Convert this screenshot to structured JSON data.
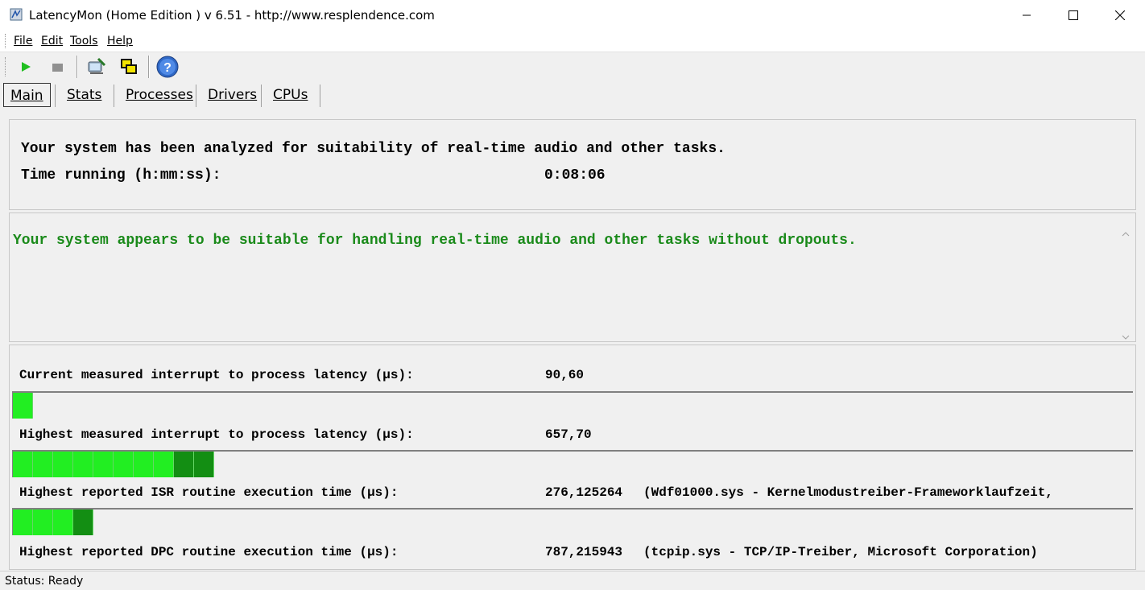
{
  "window": {
    "title": "LatencyMon  (Home Edition )  v 6.51 - http://www.resplendence.com",
    "icons": {
      "minimize": "minimize-icon",
      "maximize": "maximize-icon",
      "close": "close-icon"
    }
  },
  "menu": {
    "items": [
      {
        "label": "File"
      },
      {
        "label": "Edit"
      },
      {
        "label": "Tools"
      },
      {
        "label": "Help"
      }
    ]
  },
  "toolbar": {
    "buttons": [
      "play-icon",
      "stop-icon",
      "computer-tools-icon",
      "windows-icon",
      "help-icon"
    ]
  },
  "tabs": [
    {
      "label": "Main",
      "active": true
    },
    {
      "label": "Stats"
    },
    {
      "label": "Processes"
    },
    {
      "label": "Drivers"
    },
    {
      "label": "CPUs"
    }
  ],
  "summary": {
    "analyzed_text": "Your system has been analyzed for suitability of real-time audio and other tasks.",
    "time_label": "Time running (h:mm:ss):",
    "time_value": "0:08:06"
  },
  "verdict": {
    "text": "Your system appears to be suitable for handling real-time audio and other tasks without dropouts.",
    "color": "#1a8a1a"
  },
  "metrics": [
    {
      "label": "Current measured interrupt to process latency (µs):",
      "value": "90,60",
      "detail": "",
      "bar_segments": 1
    },
    {
      "label": "Highest measured interrupt to process latency (µs):",
      "value": "657,70",
      "detail": "",
      "bar_segments": 10
    },
    {
      "label": "Highest reported ISR routine execution time (µs):",
      "value": "276,125264",
      "detail": "(Wdf01000.sys - Kernelmodustreiber-Frameworklaufzeit,",
      "bar_segments": 4
    },
    {
      "label": "Highest reported DPC routine execution time (µs):",
      "value": "787,215943",
      "detail": "(tcpip.sys - TCP/IP-Treiber, Microsoft Corporation)",
      "bar_segments": 0
    }
  ],
  "status": {
    "text": "Status: Ready"
  },
  "colors": {
    "bar_light": "#22ee22",
    "bar_dark": "#138e13"
  }
}
